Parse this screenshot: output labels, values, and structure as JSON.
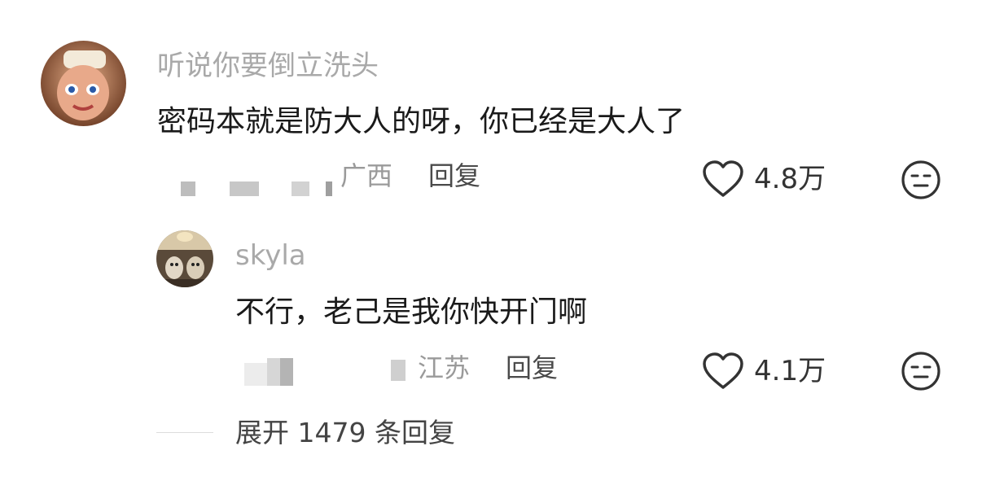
{
  "comments": [
    {
      "username": "听说你要倒立洗头",
      "text": "密码本就是防大人的呀，你已经是大人了",
      "location": "广西",
      "reply_label": "回复",
      "likes": "4.8万"
    },
    {
      "username": "skyla",
      "text": "不行，老己是我你快开门啊",
      "location": "江苏",
      "reply_label": "回复",
      "likes": "4.1万"
    }
  ],
  "expand_replies": "展开 1479 条回复",
  "icons": {
    "like": "heart-outline-icon",
    "dislike": "meh-face-icon"
  },
  "colors": {
    "username": "#a9a9a9",
    "text": "#1a1a1a",
    "location": "#9a9a9a",
    "icon": "#333333"
  }
}
